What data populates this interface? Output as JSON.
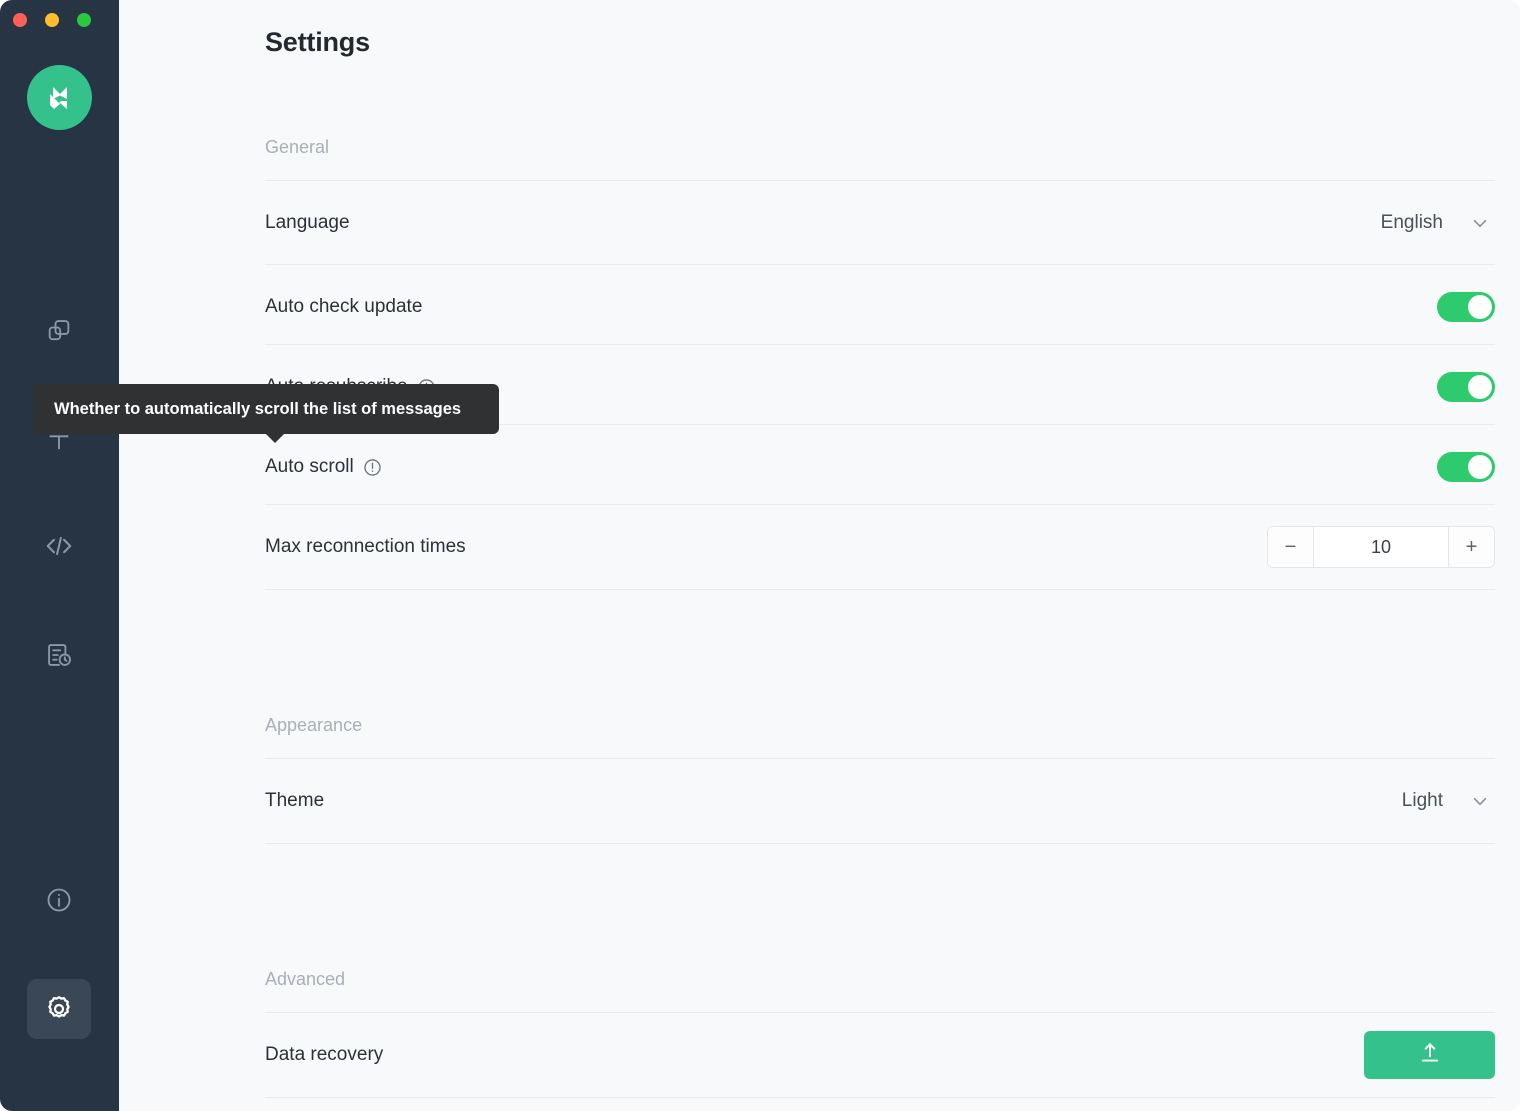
{
  "window": {
    "traffic_lights": [
      {
        "name": "close",
        "color": "#FF5F57"
      },
      {
        "name": "minimize",
        "color": "#FEBC2E"
      },
      {
        "name": "maximize",
        "color": "#28C840"
      }
    ],
    "sidebar_bg": "#273443",
    "main_bg": "#F8F9FB",
    "accent_green": "#34C18C",
    "toggle_green": "#2DCA6E"
  },
  "sidebar": {
    "logo_name": "mqttx-logo",
    "items": [
      {
        "name": "connections",
        "icon": "copy-squares-icon",
        "active": false
      },
      {
        "name": "new-connection",
        "icon": "plus-icon",
        "active": false
      },
      {
        "name": "scripts",
        "icon": "code-brackets-icon",
        "active": false
      },
      {
        "name": "logs",
        "icon": "log-history-icon",
        "active": false
      },
      {
        "name": "about",
        "icon": "info-circle-icon",
        "active": false
      },
      {
        "name": "settings",
        "icon": "gear-icon",
        "active": true
      }
    ]
  },
  "header": {
    "title": "Settings"
  },
  "sections": {
    "general": {
      "label": "General",
      "rows": {
        "language": {
          "label": "Language",
          "control": "select",
          "value": "English",
          "chevron": "chevron-down-icon"
        },
        "auto_check_update": {
          "label": "Auto check update",
          "control": "toggle",
          "value": "on"
        },
        "auto_resubscribe": {
          "label": "Auto resubscribe",
          "control": "toggle",
          "value": "on",
          "has_info_icon": true
        },
        "auto_scroll": {
          "label": "Auto scroll",
          "control": "toggle",
          "value": "on",
          "has_info_icon": true
        },
        "max_reconnection_times": {
          "label": "Max reconnection times",
          "control": "stepper",
          "value": "10",
          "decrement_label": "−",
          "increment_label": "+"
        }
      }
    },
    "appearance": {
      "label": "Appearance",
      "rows": {
        "theme": {
          "label": "Theme",
          "control": "select",
          "value": "Light",
          "chevron": "chevron-down-icon"
        }
      }
    },
    "advanced": {
      "label": "Advanced",
      "rows": {
        "data_recovery": {
          "label": "Data recovery",
          "control": "button",
          "icon": "upload-icon"
        }
      }
    }
  },
  "tooltip": {
    "text": "Whether to automatically scroll the list of messages",
    "target": "auto-scroll-info-icon",
    "bg": "#303133"
  }
}
